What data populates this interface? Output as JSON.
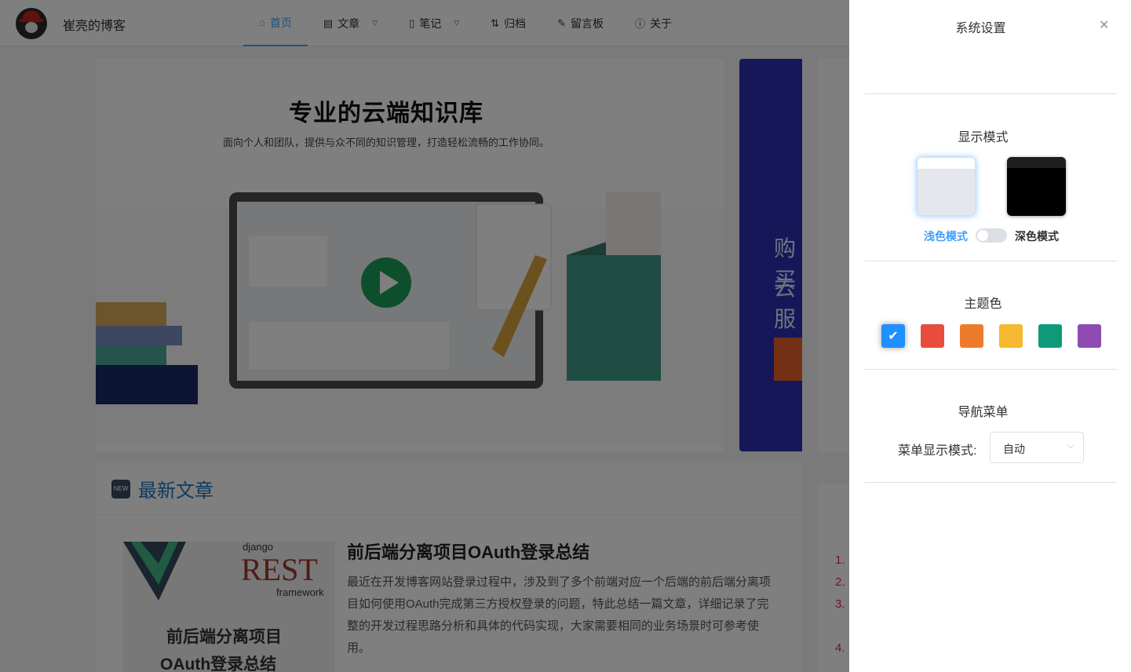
{
  "header": {
    "site_name": "崔亮的博客",
    "nav": [
      {
        "label": "首页",
        "icon": "home-icon",
        "active": true
      },
      {
        "label": "文章",
        "icon": "document-icon",
        "dropdown": true
      },
      {
        "label": "笔记",
        "icon": "notebook-icon",
        "dropdown": true
      },
      {
        "label": "归档",
        "icon": "sort-icon"
      },
      {
        "label": "留言板",
        "icon": "edit-icon"
      },
      {
        "label": "关于",
        "icon": "info-icon"
      }
    ]
  },
  "banner": {
    "title": "专业的云端知识库",
    "subtitle": "面向个人和团队，提供与众不同的知识管理，打造轻松流畅的工作协同。"
  },
  "ad": {
    "line1": "购买",
    "line2": "云服"
  },
  "latest": {
    "badge": "NEW",
    "title": "最新文章",
    "article": {
      "title": "前后端分离项目OAuth登录总结",
      "desc": "最近在开发博客网站登录过程中，涉及到了多个前端对应一个后端的前后端分离项目如何使用OAuth完成第三方授权登录的问题，特此总结一篇文章，详细记录了完整的开发过程思路分析和具体的代码实现，大家需要相同的业务场景时可参考使用。",
      "thumb_text1": "前后端分离项目",
      "thumb_text2": "OAuth登录总结",
      "thumb_django": "django",
      "thumb_rest": "REST",
      "thumb_framework": "framework"
    }
  },
  "hot_list": [
    "1.",
    "2.",
    "3.",
    "4."
  ],
  "drawer": {
    "title": "系统设置",
    "close_icon": "close-icon",
    "display_mode": {
      "title": "显示模式",
      "light_label": "浅色模式",
      "dark_label": "深色模式",
      "selected": "light"
    },
    "theme": {
      "title": "主题色",
      "colors": [
        "#1e90ff",
        "#e74c3c",
        "#ee7a2b",
        "#f5b82e",
        "#0e9a78",
        "#8e4bb1"
      ],
      "selected_index": 0
    },
    "nav_menu": {
      "title": "导航菜单",
      "label": "菜单显示模式:",
      "value": "自动"
    }
  }
}
